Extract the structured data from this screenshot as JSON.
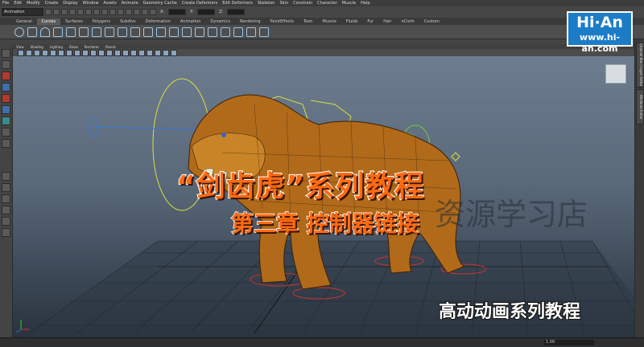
{
  "menu": [
    "File",
    "Edit",
    "Modify",
    "Create",
    "Display",
    "Window",
    "Assets",
    "Animate",
    "Geometry Cache",
    "Create Deformers",
    "Edit Deformers",
    "Skeleton",
    "Skin",
    "Constrain",
    "Character",
    "Muscle",
    "Help"
  ],
  "status": {
    "mode": "Animation",
    "x_label": "X:",
    "y_label": "Y:",
    "z_label": "Z:"
  },
  "shelf_tabs": [
    "General",
    "Curves",
    "Surfaces",
    "Polygons",
    "Subdivs",
    "Deformation",
    "Animation",
    "Dynamics",
    "Rendering",
    "PaintEffects",
    "Toon",
    "Muscle",
    "Fluids",
    "Fur",
    "Hair",
    "nCloth",
    "Custom"
  ],
  "panel_menu": [
    "View",
    "Shading",
    "Lighting",
    "Show",
    "Renderer",
    "Panels"
  ],
  "right_tabs": [
    "Channel Box / Layer Editor",
    "Attribute Editor"
  ],
  "logo": {
    "title": "Hi·An",
    "url": "www.hi-an.com"
  },
  "overlay": {
    "title": "“剑齿虎”系列教程",
    "chapter": "第三章 控制器链接",
    "watermark": "资源学习店",
    "subtitle": "高动动画系列教程"
  },
  "timeline": {
    "value": "1.00"
  }
}
